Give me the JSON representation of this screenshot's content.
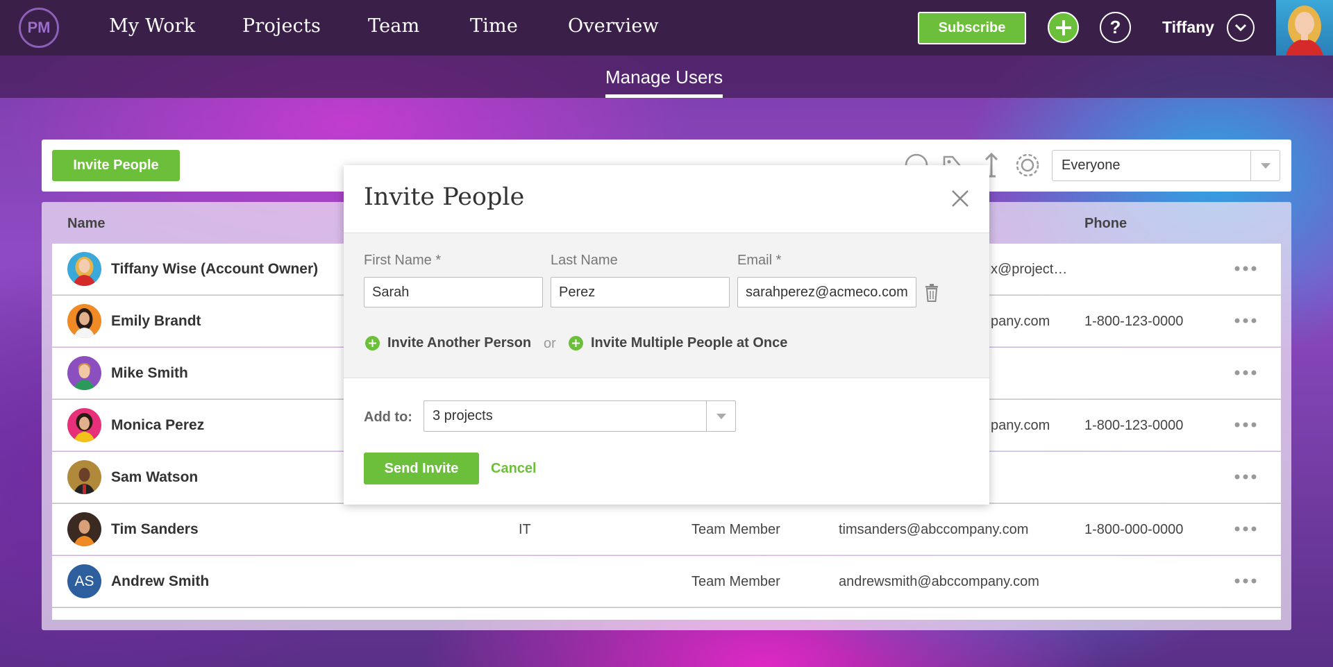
{
  "brand": {
    "logo_text": "PM",
    "accent": "#6cbf3a",
    "topbar_bg": "#3a1f48"
  },
  "nav": {
    "items": [
      {
        "label": "My Work"
      },
      {
        "label": "Projects"
      },
      {
        "label": "Team"
      },
      {
        "label": "Time"
      },
      {
        "label": "Overview"
      }
    ],
    "subscribe_label": "Subscribe",
    "add_icon": "plus-icon",
    "help_icon": "question-icon",
    "user_name": "Tiffany"
  },
  "subheader": {
    "title": "Manage Users"
  },
  "toolbar": {
    "invite_label": "Invite People",
    "icons": [
      "search-icon",
      "tag-icon",
      "sort-icon",
      "gear-icon"
    ],
    "filter_value": "Everyone"
  },
  "table": {
    "headers": {
      "name": "Name",
      "phone": "Phone"
    },
    "rows": [
      {
        "name": "Tiffany Wise (Account Owner)",
        "department": "",
        "role": "",
        "email": "x@project…",
        "phone": ""
      },
      {
        "name": "Emily Brandt",
        "department": "",
        "role": "",
        "email": "pany.com",
        "phone": "1-800-123-0000"
      },
      {
        "name": "Mike Smith",
        "department": "",
        "role": "",
        "email": "",
        "phone": ""
      },
      {
        "name": "Monica Perez",
        "department": "",
        "role": "",
        "email": "pany.com",
        "phone": "1-800-123-0000"
      },
      {
        "name": "Sam Watson",
        "department": "",
        "role": "",
        "email": "",
        "phone": ""
      },
      {
        "name": "Tim Sanders",
        "department": "IT",
        "role": "Team Member",
        "email": "timsanders@abccompany.com",
        "phone": "1-800-000-0000"
      },
      {
        "name": "Andrew Smith",
        "department": "",
        "role": "Team Member",
        "email": "andrewsmith@abccompany.com",
        "phone": "",
        "initials": "AS"
      }
    ]
  },
  "modal": {
    "title": "Invite People",
    "first_name_label": "First Name *",
    "last_name_label": "Last Name",
    "email_label": "Email *",
    "first_name_value": "Sarah",
    "last_name_value": "Perez",
    "email_value": "sarahperez@acmeco.com",
    "invite_another_label": "Invite Another Person",
    "or_text": "or",
    "invite_multiple_label": "Invite Multiple People at Once",
    "add_to_label": "Add to:",
    "add_to_value": "3 projects",
    "send_label": "Send Invite",
    "cancel_label": "Cancel"
  }
}
